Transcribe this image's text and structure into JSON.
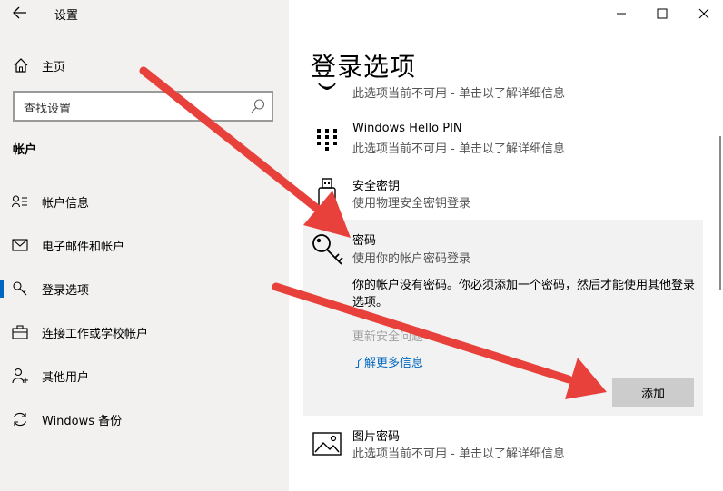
{
  "app": {
    "title": "设置"
  },
  "nav": {
    "home_label": "主页",
    "search_placeholder": "查找设置",
    "section_title": "帐户",
    "items": [
      {
        "label": "帐户信息",
        "icon": "account-info-icon"
      },
      {
        "label": "电子邮件和帐户",
        "icon": "mail-icon"
      },
      {
        "label": "登录选项",
        "icon": "key-icon",
        "active": true
      },
      {
        "label": "连接工作或学校帐户",
        "icon": "briefcase-icon"
      },
      {
        "label": "其他用户",
        "icon": "person-add-icon"
      },
      {
        "label": "Windows 备份",
        "icon": "sync-icon"
      }
    ]
  },
  "main": {
    "page_title": "登录选项",
    "options": [
      {
        "title": "",
        "subtitle": "此选项当前不可用 - 单击以了解详细信息",
        "icon": "fingerprint-icon"
      },
      {
        "title": "Windows Hello PIN",
        "subtitle": "此选项当前不可用 - 单击以了解详细信息",
        "icon": "pin-keypad-icon"
      },
      {
        "title": "安全密钥",
        "subtitle": "使用物理安全密钥登录",
        "icon": "usb-key-icon"
      }
    ],
    "password": {
      "title": "密码",
      "subtitle": "使用你的帐户密码登录",
      "description": "你的帐户没有密码。你必须添加一个密码，然后才能使用其他登录选项。",
      "disabled_link": "更新安全问题",
      "learn_more": "了解更多信息",
      "add_button": "添加"
    },
    "picture_password": {
      "title": "图片密码",
      "subtitle": "此选项当前不可用 - 单击以了解详细信息"
    }
  },
  "colors": {
    "accent": "#0067c0",
    "sidebar_bg": "#f2f1f0",
    "annotation_arrow": "#e8413b"
  }
}
